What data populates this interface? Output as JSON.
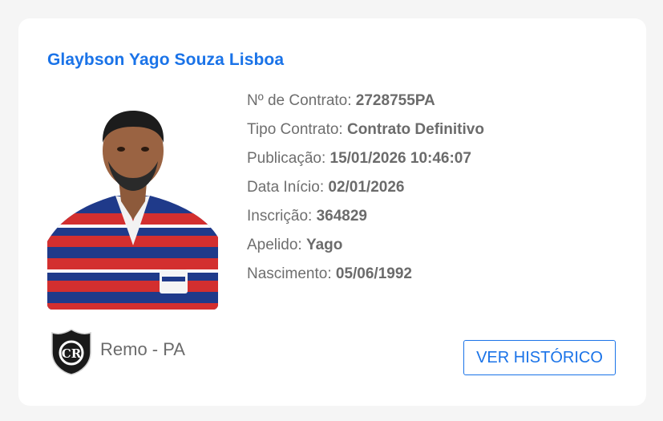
{
  "player": {
    "name": "Glaybson Yago Souza Lisboa"
  },
  "fields": [
    {
      "label": "Nº de Contrato:",
      "value": "2728755PA"
    },
    {
      "label": "Tipo Contrato:",
      "value": "Contrato Definitivo"
    },
    {
      "label": "Publicação:",
      "value": "15/01/2026 10:46:07"
    },
    {
      "label": "Data Início:",
      "value": "02/01/2026"
    },
    {
      "label": "Inscrição:",
      "value": "364829"
    },
    {
      "label": "Apelido:",
      "value": "Yago"
    },
    {
      "label": "Nascimento:",
      "value": "05/06/1992"
    }
  ],
  "club": {
    "name": "Remo - PA",
    "logo_icon": "remo-crest-icon",
    "logo_text": "CR"
  },
  "actions": {
    "history_label": "VER HISTÓRICO"
  },
  "colors": {
    "accent": "#1a73e8",
    "text": "#6e6e6e",
    "card": "#ffffff",
    "background": "#f5f5f5"
  }
}
